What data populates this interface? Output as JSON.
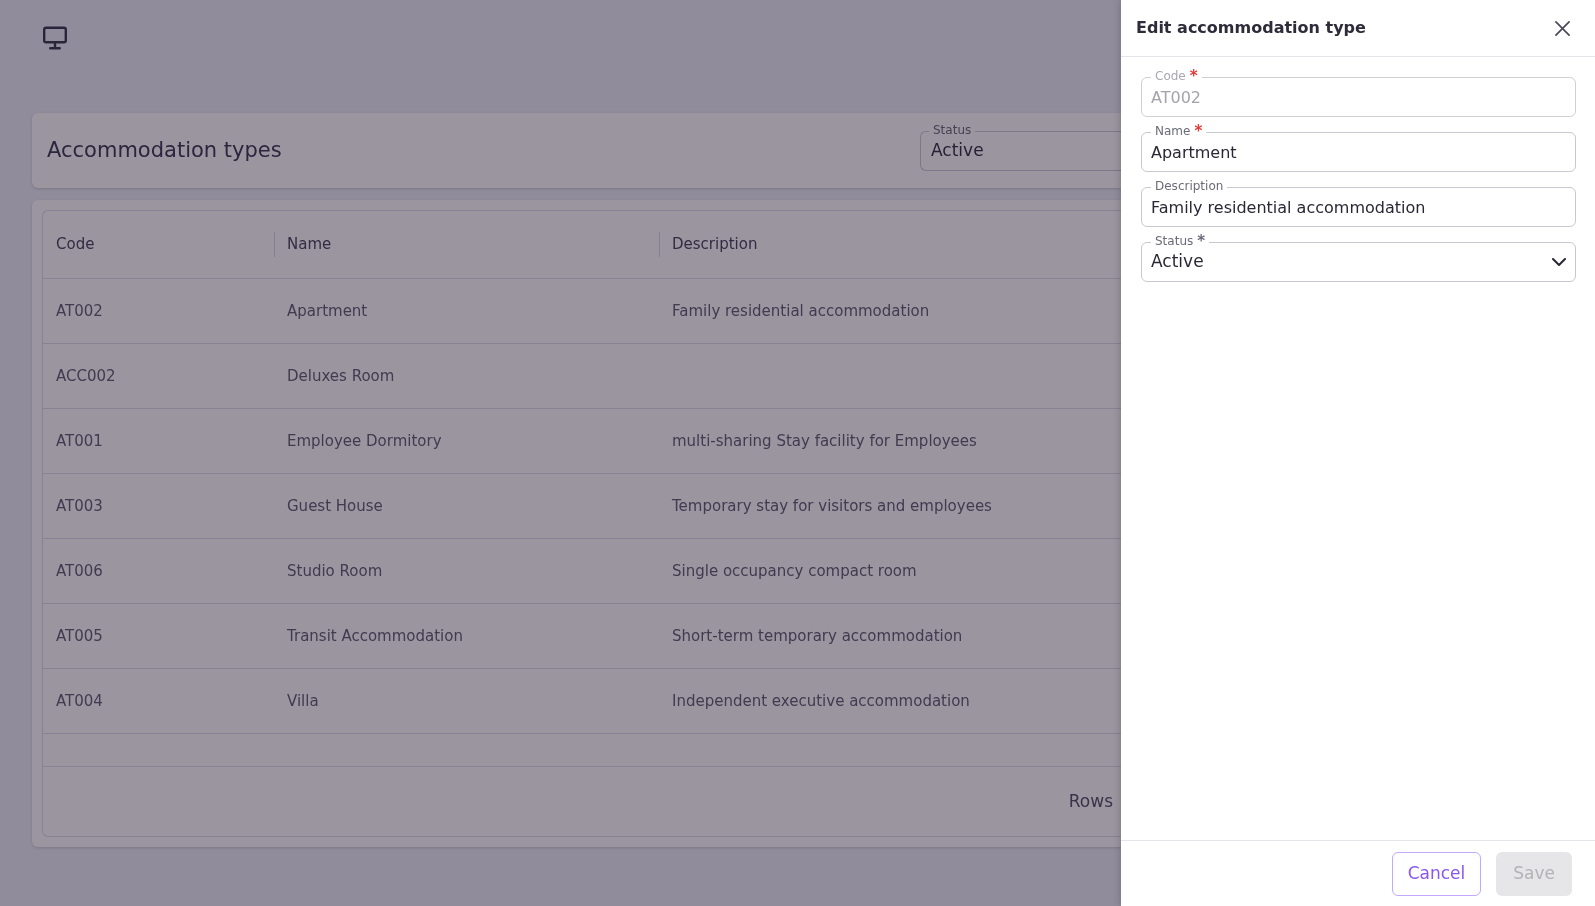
{
  "page": {
    "title": "Accommodation types",
    "status_filter": {
      "label": "Status",
      "value": "Active"
    },
    "table": {
      "columns": [
        "Code",
        "Name",
        "Description"
      ],
      "rows": [
        {
          "code": "AT002",
          "name": "Apartment",
          "description": "Family residential accommodation"
        },
        {
          "code": "ACC002",
          "name": "Deluxes Room"
        },
        {
          "code": "AT001",
          "name": "Employee Dormitory",
          "description": "multi-sharing Stay facility for Employees"
        },
        {
          "code": "AT003",
          "name": "Guest House",
          "description": "Temporary stay for visitors and employees"
        },
        {
          "code": "AT006",
          "name": "Studio Room",
          "description": "Single occupancy compact room"
        },
        {
          "code": "AT005",
          "name": "Transit Accommodation",
          "description": "Short-term temporary accommodation"
        },
        {
          "code": "AT004",
          "name": "Villa",
          "description": "Independent executive accommodation"
        }
      ],
      "footer": {
        "rows_label": "Rows"
      }
    }
  },
  "drawer": {
    "title": "Edit accommodation type",
    "fields": [
      {
        "kind": "text",
        "label": "Code",
        "required_mark": {
          "text": "*",
          "color": "#e53935"
        },
        "value": "AT002",
        "disabled": true
      },
      {
        "kind": "text",
        "label": "Name",
        "required_mark": {
          "text": "*",
          "color": "#e53935"
        },
        "value": "Apartment",
        "disabled": false
      },
      {
        "kind": "text",
        "label": "Description",
        "value": "Family residential accommodation",
        "disabled": false
      },
      {
        "kind": "select",
        "label": "Status",
        "required_mark": {
          "text": "*",
          "color": "#6b6b78"
        },
        "value": "Active",
        "disabled": false
      }
    ],
    "buttons": [
      {
        "label": "Cancel",
        "kind": "outlined",
        "disabled": false
      },
      {
        "label": "Save",
        "kind": "contained",
        "disabled": true
      }
    ]
  }
}
